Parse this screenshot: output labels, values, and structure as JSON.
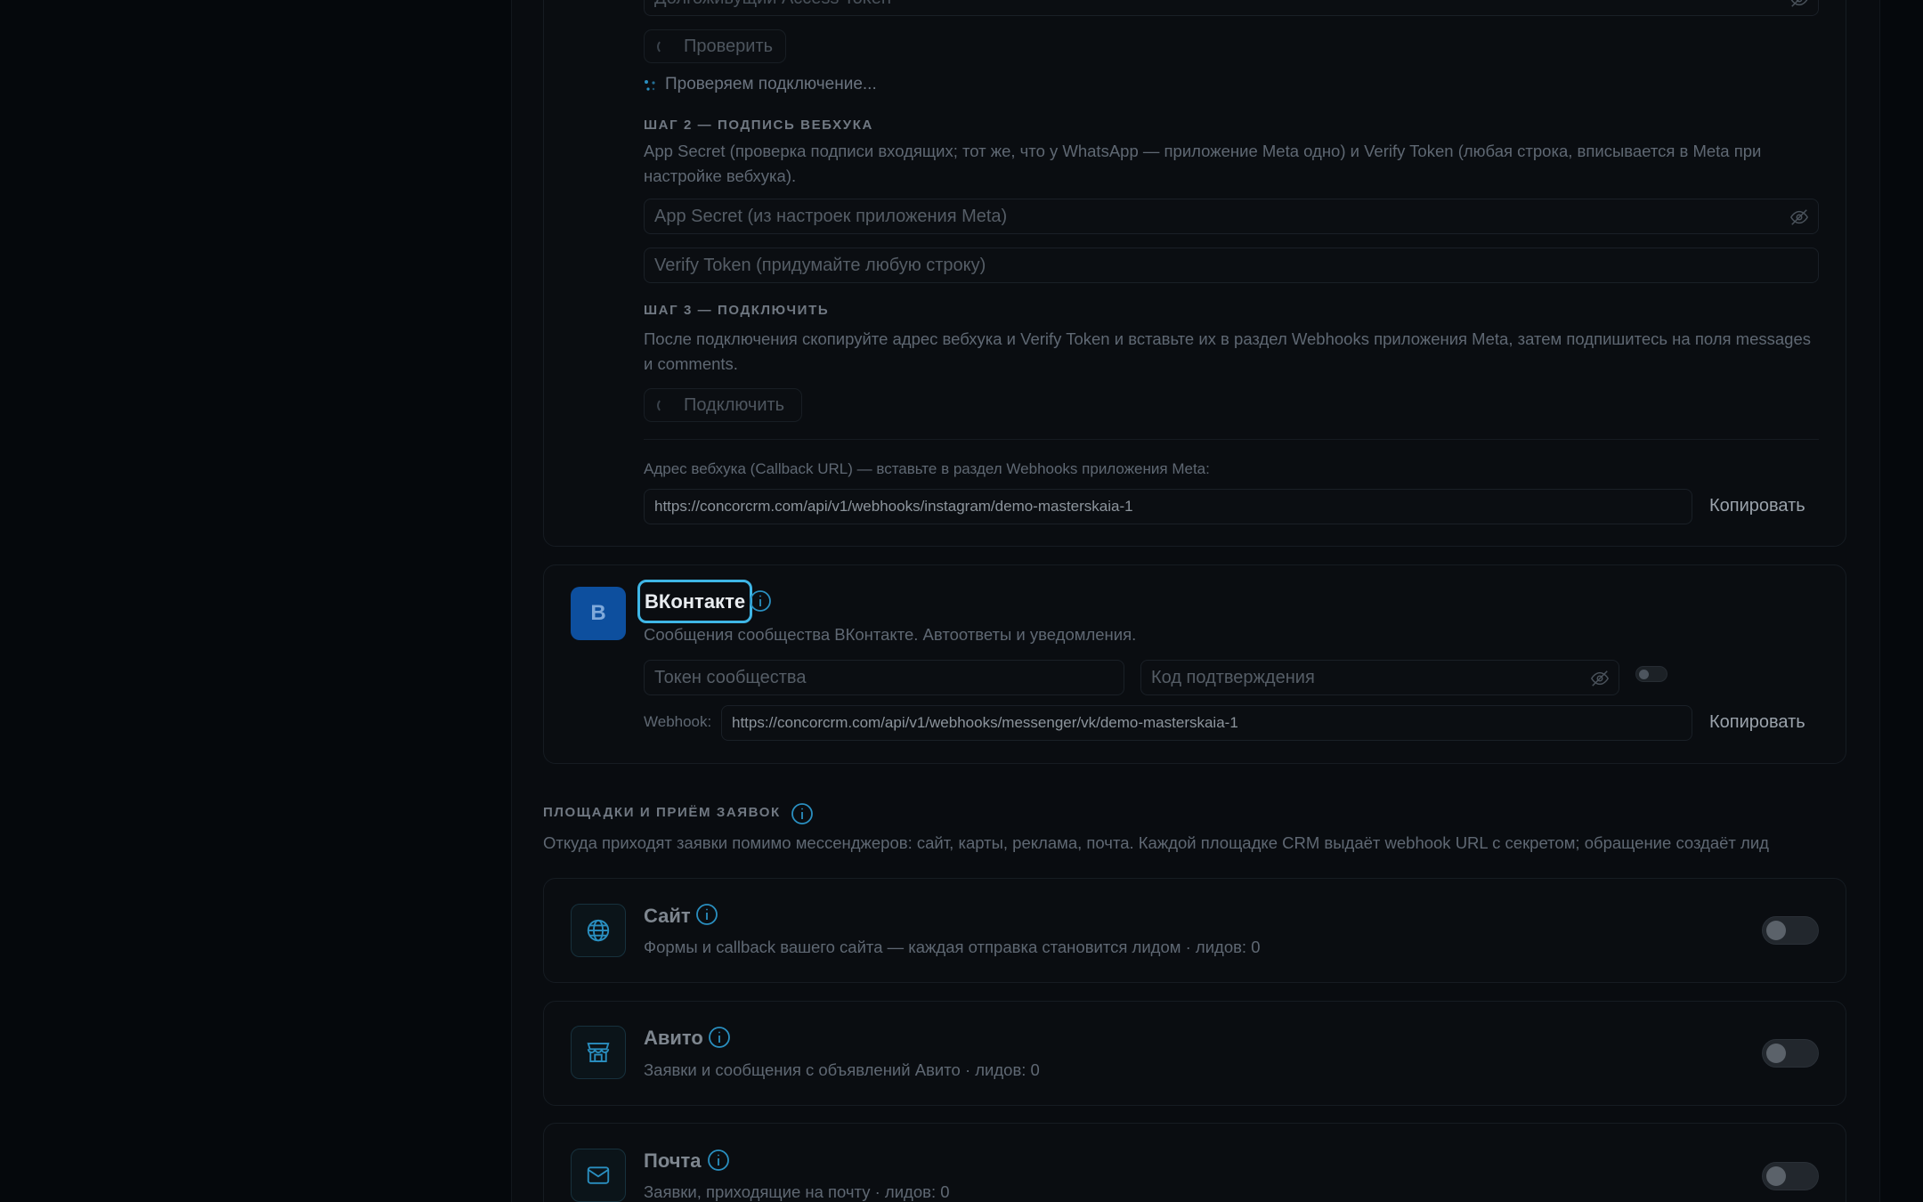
{
  "instagram": {
    "token_placeholder": "Долгоживущий Access Token",
    "check_button": "Проверить",
    "checking_status": "Проверяем подключение...",
    "step2_title": "ШАГ 2 — ПОДПИСЬ ВЕБХУКА",
    "step2_desc": "App Secret (проверка подписи входящих; тот же, что у WhatsApp — приложение Meta одно) и Verify Token (любая строка, вписывается в Meta при настройке вебхука).",
    "app_secret_placeholder": "App Secret (из настроек приложения Meta)",
    "verify_token_placeholder": "Verify Token (придумайте любую строку)",
    "step3_title": "ШАГ 3 — ПОДКЛЮЧИТЬ",
    "step3_desc": "После подключения скопируйте адрес вебхука и Verify Token и вставьте их в раздел Webhooks приложения Meta, затем подпишитесь на поля messages и comments.",
    "connect_button": "Подключить",
    "callback_label": "Адрес вебхука (Callback URL) — вставьте в раздел Webhooks приложения Meta:",
    "callback_url": "https://concorcrm.com/api/v1/webhooks/instagram/demo-masterskaia-1",
    "copy_label": "Копировать"
  },
  "vk": {
    "avatar_letter": "В",
    "title": "ВКонтакте",
    "desc": "Сообщения сообщества ВКонтакте. Автоответы и уведомления.",
    "token_placeholder": "Токен сообщества",
    "code_placeholder": "Код подтверждения",
    "webhook_label": "Webhook:",
    "webhook_url": "https://concorcrm.com/api/v1/webhooks/messenger/vk/demo-masterskaia-1",
    "copy_label": "Копировать",
    "enabled": false
  },
  "sources": {
    "section_title": "ПЛОЩАДКИ И ПРИЁМ ЗАЯВОК",
    "section_desc": "Откуда приходят заявки помимо мессенджеров: сайт, карты, реклама, почта. Каждой площадке CRM выдаёт webhook URL с секретом; обращение создаёт лид",
    "items": [
      {
        "title": "Сайт",
        "desc": "Формы и callback вашего сайта — каждая отправка становится лидом · лидов: 0",
        "icon": "globe-icon",
        "enabled": false
      },
      {
        "title": "Авито",
        "desc": "Заявки и сообщения с объявлений Авито · лидов: 0",
        "icon": "store-icon",
        "enabled": false
      },
      {
        "title": "Почта",
        "desc": "Заявки, приходящие на почту · лидов: 0",
        "icon": "mail-icon",
        "enabled": false
      }
    ]
  },
  "colors": {
    "accent": "#2a8fc0",
    "focus_ring": "#3fb6e6",
    "vk_avatar": "#0d4f9e"
  }
}
